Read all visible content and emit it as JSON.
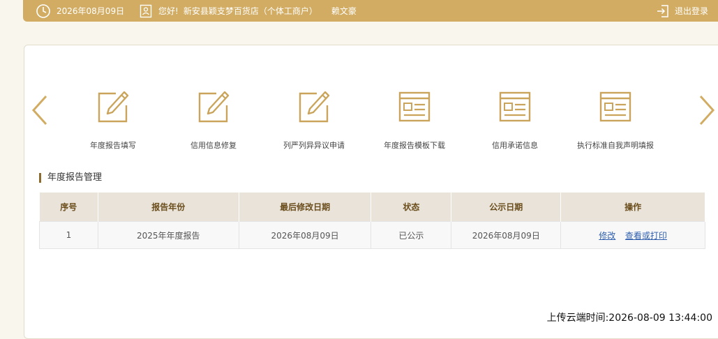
{
  "header": {
    "date": "2026年08月09日",
    "greeting": "您好!",
    "shop_name": "新安县颖支梦百货店（个体工商户）",
    "user_name": "赖文豪",
    "logout_label": "退出登录"
  },
  "shortcuts": [
    {
      "label": "年度报告填写",
      "icon": "edit-icon"
    },
    {
      "label": "信用信息修复",
      "icon": "edit-icon"
    },
    {
      "label": "列严列异异议申请",
      "icon": "edit-icon"
    },
    {
      "label": "年度报告模板下载",
      "icon": "document-window-icon"
    },
    {
      "label": "信用承诺信息",
      "icon": "document-window-icon"
    },
    {
      "label": "执行标准自我声明填报",
      "icon": "document-window-icon"
    }
  ],
  "section_title": "年度报告管理",
  "table": {
    "headers": [
      "序号",
      "报告年份",
      "最后修改日期",
      "状态",
      "公示日期",
      "操作"
    ],
    "rows": [
      {
        "index": "1",
        "year": "2025年年度报告",
        "modified": "2026年08月09日",
        "status": "已公示",
        "public_date": "2026年08月09日",
        "action_edit": "修改",
        "action_view": "查看或打印"
      }
    ]
  },
  "footer": {
    "upload_time": "上传云端时间:2026-08-09 13:44:00"
  },
  "colors": {
    "accent": "#d1ac62",
    "icon": "#c9a45a",
    "header_text": "#6a4d1b",
    "link": "#2f5fae"
  }
}
